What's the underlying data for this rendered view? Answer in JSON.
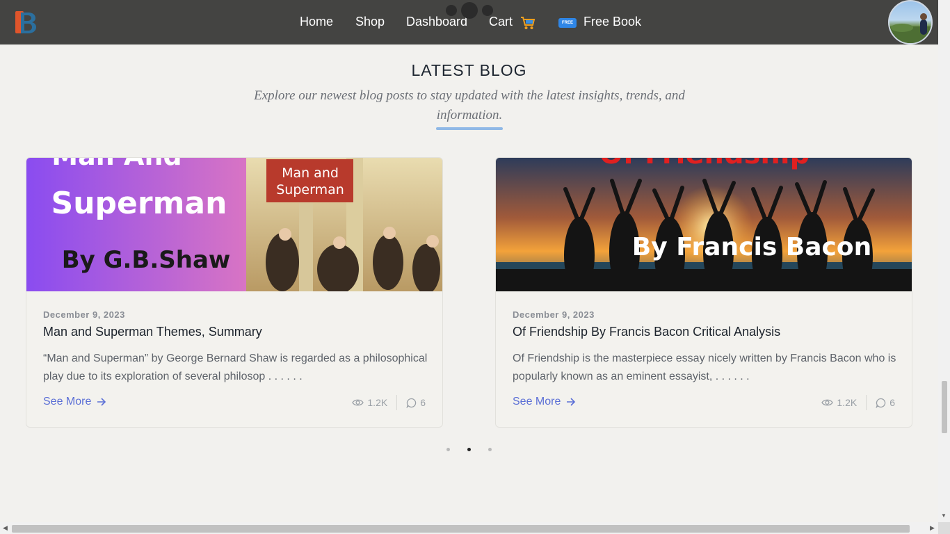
{
  "nav": {
    "home": "Home",
    "shop": "Shop",
    "dashboard": "Dashboard",
    "cart": "Cart",
    "free_book": "Free Book",
    "free_badge": "FREE"
  },
  "section": {
    "title": "LATEST BLOG",
    "subtitle": "Explore our newest blog posts to stay updated with the latest insights, trends, and information."
  },
  "cards": [
    {
      "date": "December 9, 2023",
      "title": "Man and Superman Themes, Summary",
      "description": "“Man and Superman” by George Bernard Shaw is regarded as a philosophical play due to its exploration of several philosop . . . . . .",
      "see_more": "See More",
      "views": "1.2K",
      "comments": "6",
      "image_text": {
        "top": "Man And",
        "main": "Superman",
        "by": "By G.B.Shaw",
        "book": "Man and Superman"
      }
    },
    {
      "date": "December 9, 2023",
      "title": "Of Friendship By Francis Bacon Critical Analysis",
      "description": "Of Friendship is the masterpiece essay nicely written by Francis Bacon who is popularly known as an eminent essayist, . . . . . .",
      "see_more": "See More",
      "views": "1.2K",
      "comments": "6",
      "image_text": {
        "top": "Of Friendship",
        "by": "By Francis Bacon"
      }
    }
  ],
  "pager": {
    "count": 3,
    "active_index": 1
  },
  "colors": {
    "header_bg": "#444442",
    "page_bg": "#f2f1ee",
    "accent_link": "#5b6fd6",
    "underline": "#8fb8e6"
  },
  "icons": [
    "logo-icon",
    "cart-icon",
    "free-badge-icon",
    "eye-icon",
    "comment-icon",
    "arrow-right-icon",
    "avatar"
  ]
}
